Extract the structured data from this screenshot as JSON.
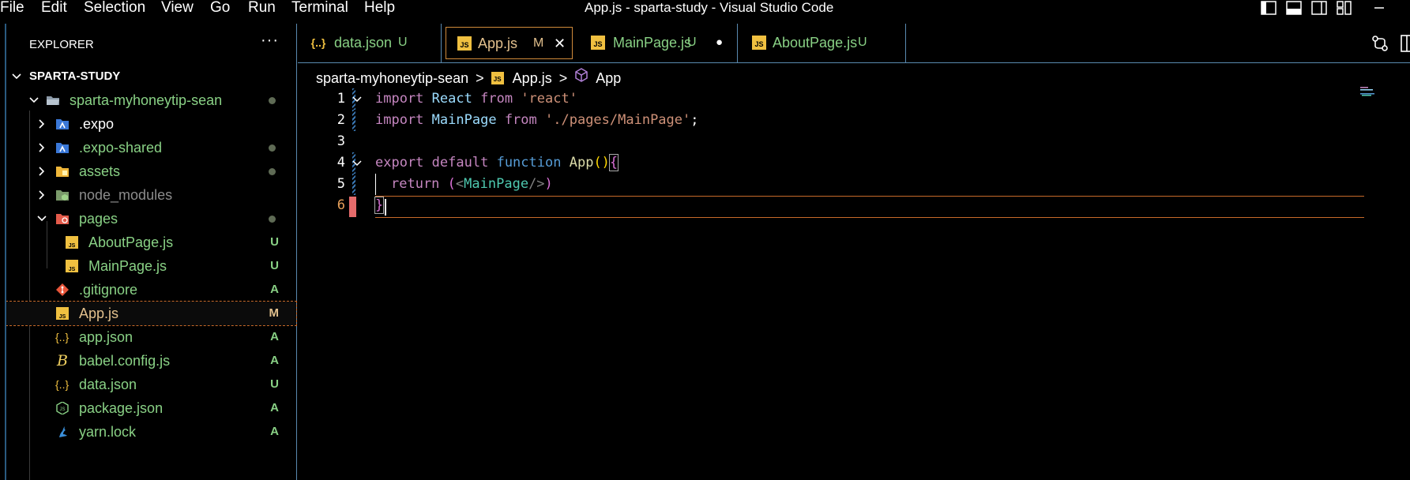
{
  "menu": [
    "File",
    "Edit",
    "Selection",
    "View",
    "Go",
    "Run",
    "Terminal",
    "Help"
  ],
  "window_title": "App.js - sparta-study - Visual Studio Code",
  "explorer": {
    "title": "EXPLORER",
    "more": "···",
    "root": "SPARTA-STUDY",
    "items": [
      {
        "label": "sparta-myhoneytip-sean",
        "status": "",
        "dot": true,
        "color": "#89d185"
      },
      {
        "label": ".expo",
        "status": "",
        "dot": false,
        "color": "#ffffff"
      },
      {
        "label": ".expo-shared",
        "status": "",
        "dot": true,
        "color": "#89d185"
      },
      {
        "label": "assets",
        "status": "",
        "dot": true,
        "color": "#89d185"
      },
      {
        "label": "node_modules",
        "status": "",
        "dot": false,
        "color": "#8c8c8c"
      },
      {
        "label": "pages",
        "status": "",
        "dot": true,
        "color": "#89d185"
      },
      {
        "label": "AboutPage.js",
        "status": "U",
        "dot": false,
        "color": "#89d185"
      },
      {
        "label": "MainPage.js",
        "status": "U",
        "dot": false,
        "color": "#89d185"
      },
      {
        "label": ".gitignore",
        "status": "A",
        "dot": false,
        "color": "#89d185"
      },
      {
        "label": "App.js",
        "status": "M",
        "dot": false,
        "color": "#e2c08d"
      },
      {
        "label": "app.json",
        "status": "A",
        "dot": false,
        "color": "#89d185"
      },
      {
        "label": "babel.config.js",
        "status": "A",
        "dot": false,
        "color": "#89d185"
      },
      {
        "label": "data.json",
        "status": "U",
        "dot": false,
        "color": "#89d185"
      },
      {
        "label": "package.json",
        "status": "A",
        "dot": false,
        "color": "#89d185"
      },
      {
        "label": "yarn.lock",
        "status": "A",
        "dot": false,
        "color": "#89d185"
      }
    ]
  },
  "tabs": [
    {
      "icon": "{..}",
      "label": "data.json",
      "status": "U",
      "color": "#89d185"
    },
    {
      "icon": "JS",
      "label": "App.js",
      "status": "M",
      "color": "#e2c08d",
      "close": "✕"
    },
    {
      "icon": "JS",
      "label": "MainPage.js",
      "status": "U",
      "color": "#89d185",
      "dot": "●"
    },
    {
      "icon": "JS",
      "label": "AboutPage.js",
      "status": "U",
      "color": "#89d185"
    }
  ],
  "breadcrumb": {
    "folder": "sparta-myhoneytip-sean",
    "file": "App.js",
    "symbol": "App",
    "sep": ">"
  },
  "editor": {
    "line_numbers": [
      "1",
      "2",
      "3",
      "4",
      "5",
      "6"
    ],
    "line1": {
      "import": "import",
      "name": "React",
      "from": "from",
      "src": "'react'"
    },
    "line2": {
      "import": "import",
      "name": "MainPage",
      "from": "from",
      "src": "'./pages/MainPage'",
      "semi": ";"
    },
    "line4": {
      "export": "export",
      "default": "default",
      "function": "function",
      "name": "App",
      "parens": "()",
      "brace": "{"
    },
    "line5": {
      "return": "return",
      "open": "(",
      "lt": "<",
      "tag": "MainPage",
      "selfclose": "/>",
      "close": ")"
    },
    "line6": {
      "brace": "}"
    }
  },
  "colors": {
    "accent": "#d08a3a",
    "untracked": "#89d185",
    "modified": "#e2c08d"
  }
}
